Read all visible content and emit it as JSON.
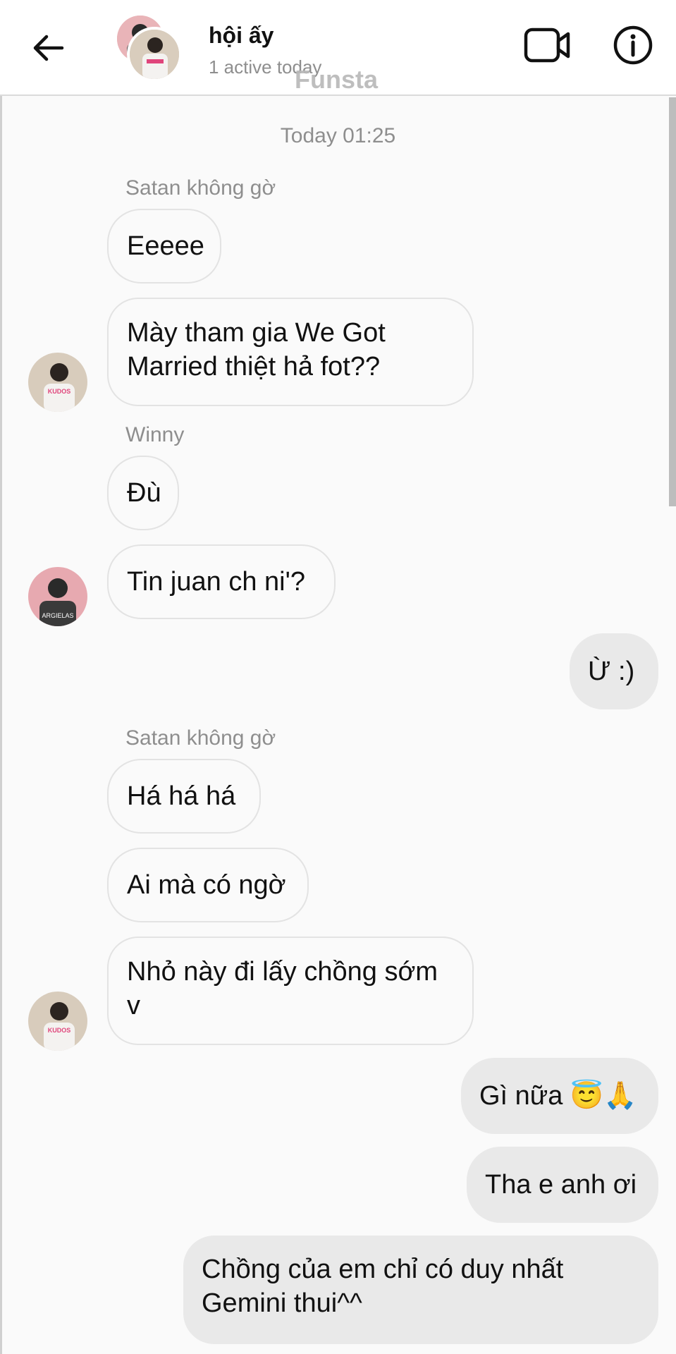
{
  "header": {
    "title": "hội ấy",
    "subtitle": "1 active today",
    "watermark": "Funsta"
  },
  "icons": {
    "back": "arrow-left-icon",
    "video": "video-camera-icon",
    "info": "info-icon"
  },
  "conversation": {
    "timestamp": "Today 01:25",
    "messages": [
      {
        "sender": "Satan không gờ",
        "direction": "incoming",
        "text": "Eeeee"
      },
      {
        "direction": "incoming",
        "text": "Mày tham gia We Got Married thiệt hả fot??"
      },
      {
        "sender": "Winny",
        "direction": "incoming",
        "text": "Đù"
      },
      {
        "direction": "incoming",
        "text": "Tin juan ch ni'?"
      },
      {
        "direction": "outgoing",
        "text": "Ừ :)"
      },
      {
        "sender": "Satan không gờ",
        "direction": "incoming",
        "text": "Há há há"
      },
      {
        "direction": "incoming",
        "text": "Ai mà có ngờ"
      },
      {
        "direction": "incoming",
        "text": "Nhỏ này đi lấy chồng sớm v"
      },
      {
        "direction": "outgoing",
        "text": "Gì nữa 😇🙏"
      },
      {
        "direction": "outgoing",
        "text": "Tha e anh ơi"
      },
      {
        "direction": "outgoing",
        "text": "Chồng của em chỉ có duy nhất Gemini thui^^"
      }
    ]
  },
  "avatar_shirt_text": {
    "kudos": "KUDOS",
    "argielas": "ARGIELAS"
  }
}
